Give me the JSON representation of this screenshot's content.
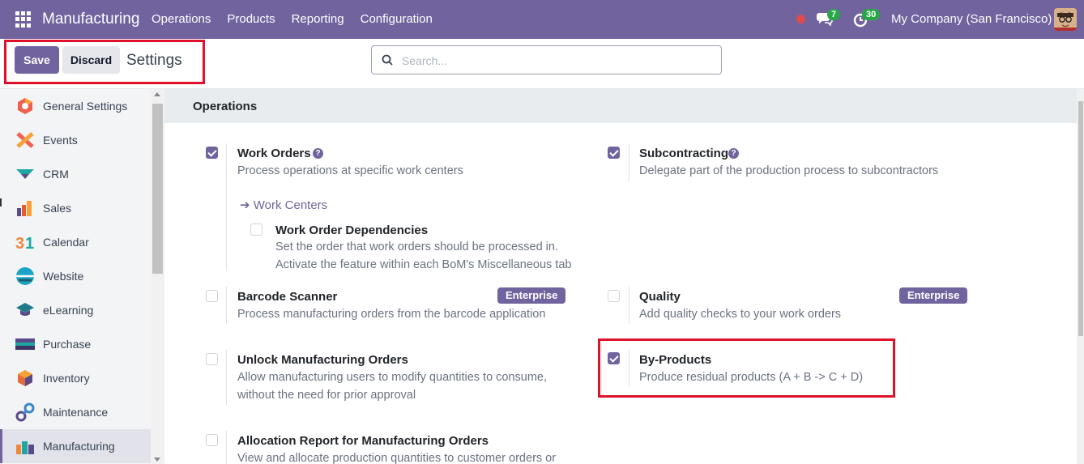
{
  "navbar": {
    "app_name": "Manufacturing",
    "menu": [
      "Operations",
      "Products",
      "Reporting",
      "Configuration"
    ],
    "chat_count": "7",
    "activity_count": "30",
    "company": "My Company (San Francisco)"
  },
  "control_panel": {
    "save_label": "Save",
    "discard_label": "Discard",
    "title": "Settings",
    "search_placeholder": "Search..."
  },
  "sidebar": {
    "items": [
      {
        "label": "General Settings",
        "icon": "general-settings-icon",
        "color": "#f06050"
      },
      {
        "label": "Events",
        "icon": "events-icon",
        "color": "#f0883e"
      },
      {
        "label": "CRM",
        "icon": "crm-icon",
        "color": "#1fa6a1"
      },
      {
        "label": "Sales",
        "icon": "sales-icon",
        "color": "#e65b30"
      },
      {
        "label": "Calendar",
        "icon": "calendar-icon",
        "color": "#f0883e"
      },
      {
        "label": "Website",
        "icon": "website-icon",
        "color": "#1ba4c5"
      },
      {
        "label": "eLearning",
        "icon": "elearning-icon",
        "color": "#1f7a8c"
      },
      {
        "label": "Purchase",
        "icon": "purchase-icon",
        "color": "#5a4a8a"
      },
      {
        "label": "Inventory",
        "icon": "inventory-icon",
        "color": "#e66a3a"
      },
      {
        "label": "Maintenance",
        "icon": "maintenance-icon",
        "color": "#3a86c9"
      },
      {
        "label": "Manufacturing",
        "icon": "manufacturing-icon",
        "color": "#f0883e"
      }
    ],
    "active": "Manufacturing"
  },
  "section": {
    "title": "Operations"
  },
  "settings": {
    "work_orders": {
      "title": "Work Orders",
      "desc": "Process operations at specific work centers",
      "checked": true
    },
    "work_centers_link": "Work Centers",
    "work_order_dependencies": {
      "title": "Work Order Dependencies",
      "desc1": "Set the order that work orders should be processed in.",
      "desc2": "Activate the feature within each BoM's Miscellaneous tab",
      "checked": false
    },
    "subcontracting": {
      "title": "Subcontracting",
      "desc": "Delegate part of the production process to subcontractors",
      "checked": true
    },
    "barcode_scanner": {
      "title": "Barcode Scanner",
      "desc": "Process manufacturing orders from the barcode application",
      "badge": "Enterprise",
      "checked": false
    },
    "quality": {
      "title": "Quality",
      "desc": "Add quality checks to your work orders",
      "badge": "Enterprise",
      "checked": false
    },
    "unlock_mo": {
      "title": "Unlock Manufacturing Orders",
      "desc1": "Allow manufacturing users to modify quantities to consume,",
      "desc2": "without the need for prior approval",
      "checked": false
    },
    "by_products": {
      "title": "By-Products",
      "desc": "Produce residual products (A + B -> C + D)",
      "checked": true
    },
    "allocation_report": {
      "title": "Allocation Report for Manufacturing Orders",
      "desc": "View and allocate production quantities to customer orders or",
      "checked": false
    }
  },
  "colors": {
    "brand": "#71639e",
    "highlight": "#e0112b",
    "badge_green": "#28a745"
  }
}
